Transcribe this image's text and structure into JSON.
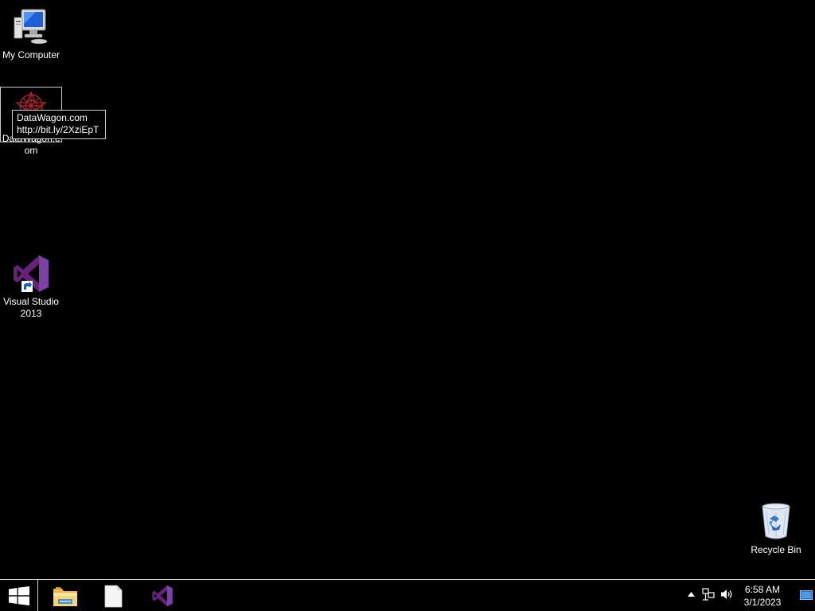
{
  "desktop": {
    "icons": {
      "my_computer": "My Computer",
      "datawagon": "DataWagon.com",
      "visual_studio": "Visual Studio 2013",
      "recycle_bin": "Recycle Bin"
    },
    "tooltip": {
      "line1": "DataWagon.com",
      "line2": "http://bit.ly/2XziEpT"
    }
  },
  "taskbar": {
    "pinned": [
      {
        "name": "file-explorer",
        "icon": "folder-icon"
      },
      {
        "name": "blank-document",
        "icon": "document-icon"
      },
      {
        "name": "visual-studio",
        "icon": "visual-studio-icon"
      }
    ],
    "clock": {
      "time": "6:58 AM",
      "date": "3/1/2023"
    }
  },
  "colors": {
    "background": "#000000",
    "vs_purple": "#68217A",
    "vs_purple_light": "#865FC5",
    "text": "#ffffff"
  }
}
